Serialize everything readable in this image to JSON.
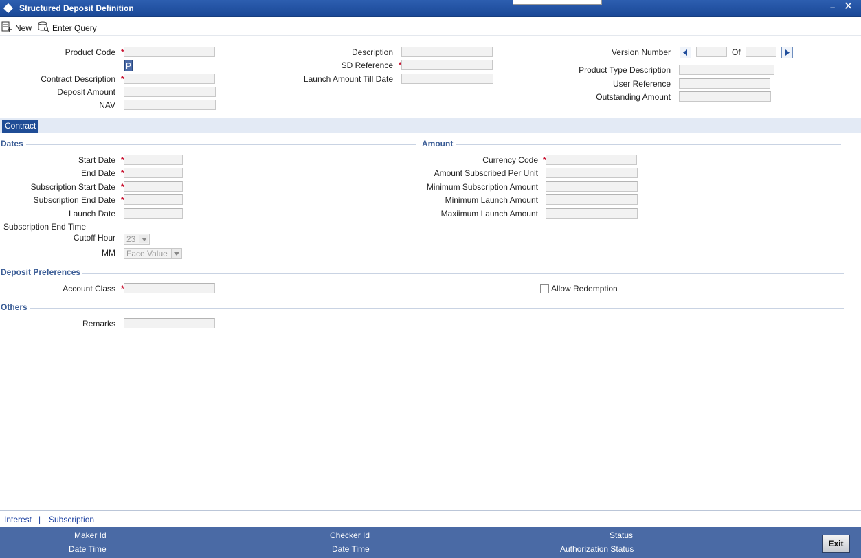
{
  "window": {
    "title": "Structured Deposit Definition",
    "minimize_glyph": "–",
    "close_glyph": "✕"
  },
  "toolbar": {
    "new_label": "New",
    "enter_query_label": "Enter Query"
  },
  "header": {
    "product_code_label": "Product Code",
    "product_pick_button": "P",
    "contract_description_label": "Contract Description",
    "deposit_amount_label": "Deposit Amount",
    "nav_label": "NAV",
    "description_label": "Description",
    "sd_reference_label": "SD Reference",
    "launch_amount_till_date_label": "Launch Amount Till Date",
    "version_number_label": "Version Number",
    "of_label": "Of",
    "product_type_description_label": "Product Type Description",
    "user_reference_label": "User Reference",
    "outstanding_amount_label": "Outstanding Amount"
  },
  "tabs": {
    "contract_label": "Contract"
  },
  "dates": {
    "section_title": "Dates",
    "start_date_label": "Start Date",
    "end_date_label": "End Date",
    "subscription_start_date_label": "Subscription Start Date",
    "subscription_end_date_label": "Subscription End Date",
    "launch_date_label": "Launch Date",
    "subscription_end_time_label": "Subscription End Time",
    "cutoff_hour_label": "Cutoff Hour",
    "cutoff_hour_value": "23",
    "mm_label": "MM",
    "mm_value": "Face Value"
  },
  "amount": {
    "section_title": "Amount",
    "currency_code_label": "Currency Code",
    "amount_subscribed_per_unit_label": "Amount Subscribed Per Unit",
    "minimum_subscription_amount_label": "Minimum Subscription Amount",
    "minimum_launch_amount_label": "Minimum Launch Amount",
    "maximum_launch_amount_label": "Maxiimum Launch Amount"
  },
  "deposit_preferences": {
    "section_title": "Deposit Preferences",
    "account_class_label": "Account Class",
    "allow_redemption_label": "Allow Redemption"
  },
  "others": {
    "section_title": "Others",
    "remarks_label": "Remarks"
  },
  "bottom_links": {
    "interest": "Interest",
    "separator": "|",
    "subscription": "Subscription"
  },
  "footer": {
    "maker_id_label": "Maker Id",
    "date_time_label_1": "Date Time",
    "checker_id_label": "Checker Id",
    "date_time_label_2": "Date Time",
    "status_label": "Status",
    "authorization_status_label": "Authorization Status",
    "exit_label": "Exit"
  },
  "required_marker": "*",
  "colors": {
    "titlebar": "#1f4d9c",
    "footer": "#4a6aa5",
    "section_heading": "#3b5d96",
    "required": "#c8102e",
    "link": "#1a3fa0"
  }
}
